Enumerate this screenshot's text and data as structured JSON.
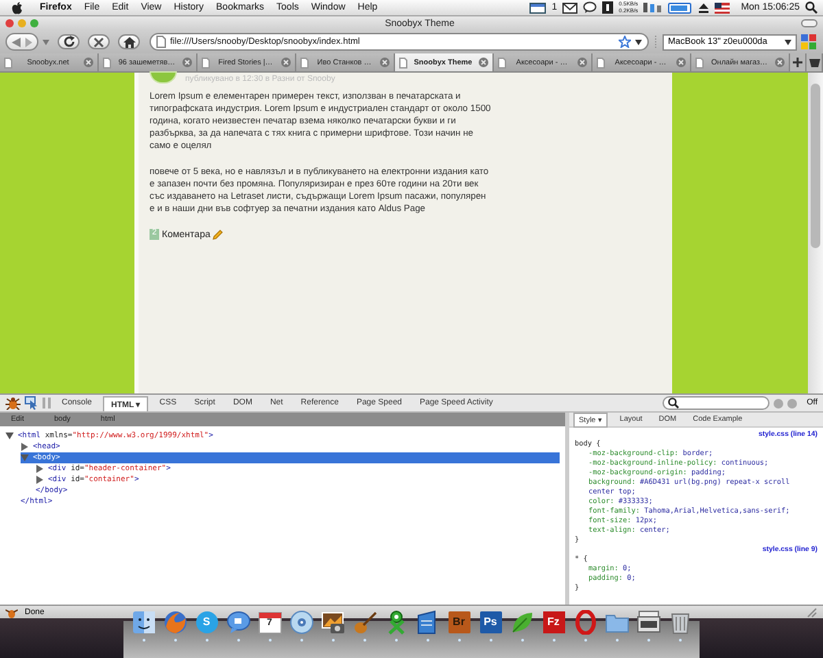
{
  "menubar": {
    "items": [
      "Firefox",
      "File",
      "Edit",
      "View",
      "History",
      "Bookmarks",
      "Tools",
      "Window",
      "Help"
    ],
    "mail_count": "1",
    "net_up": "0.5KB/s",
    "net_down": "0.2KB/s",
    "clock": "Mon 15:06:25"
  },
  "window": {
    "title": "Snoobyx Theme"
  },
  "toolbar": {
    "url": "file:///Users/snooby/Desktop/snoobyx/index.html",
    "search_value": "MacBook 13\" z0eu000da"
  },
  "tabs": [
    {
      "label": "Snoobyx.net",
      "selected": false
    },
    {
      "label": "96 зашеметяв…",
      "selected": false
    },
    {
      "label": "Fired Stories |…",
      "selected": false
    },
    {
      "label": "Иво Станков …",
      "selected": false
    },
    {
      "label": "Snoobyx Theme",
      "selected": true
    },
    {
      "label": "Аксесоари - …",
      "selected": false
    },
    {
      "label": "Аксесоари - …",
      "selected": false
    },
    {
      "label": "Онлайн магаз…",
      "selected": false
    }
  ],
  "page": {
    "meta": "публикувано в 12:30 в Разни от Snooby",
    "paragraphs": [
      "Lorem Ipsum е елементарен примерен текст, използван в печатарската и типографската индустрия. Lorem Ipsum е индустриален стандарт от около 1500 година, когато неизвестен печатар взема няколко печатарски букви и ги разбърква, за да напечата с тях книга с примерни шрифтове. Този начин не само е оцелял",
      "повече от 5 века, но е навлязъл и в публикуването на електронни издания като е запазен почти без промяна. Популяризиран е през 60те години на 20ти век със издаването на Letraset листи, съдържащи Lorem Ipsum пасажи, популярен е и в наши дни във софтуер за печатни издания като Aldus Page"
    ],
    "comment_count": "2",
    "comments_label": "Коментара"
  },
  "firebug": {
    "panels": [
      {
        "label": "Console",
        "selected": false
      },
      {
        "label": "HTML ▾",
        "selected": true
      },
      {
        "label": "CSS",
        "selected": false
      },
      {
        "label": "Script",
        "selected": false
      },
      {
        "label": "DOM",
        "selected": false
      },
      {
        "label": "Net",
        "selected": false
      },
      {
        "label": "Reference",
        "selected": false
      },
      {
        "label": "Page Speed",
        "selected": false
      },
      {
        "label": "Page Speed Activity",
        "selected": false
      }
    ],
    "off_label": "Off",
    "breadcrumbs": [
      "Edit",
      "body",
      "html"
    ],
    "side_tabs": [
      {
        "label": "Style ▾",
        "selected": true
      },
      {
        "label": "Layout",
        "selected": false
      },
      {
        "label": "DOM",
        "selected": false
      },
      {
        "label": "Code Example",
        "selected": false
      }
    ],
    "tree": [
      {
        "segments": [
          {
            "kind": "tag",
            "text": "<html "
          },
          {
            "kind": "attr",
            "text": "xmlns="
          },
          {
            "kind": "value",
            "text": "\"http://www.w3.org/1999/xhtml\""
          },
          {
            "kind": "tag",
            "text": ">"
          }
        ],
        "expanded": true,
        "selected": false,
        "close": "</html>",
        "children": [
          {
            "segments": [
              {
                "kind": "tag",
                "text": "<head>"
              }
            ],
            "expanded": false,
            "selected": false
          },
          {
            "segments": [
              {
                "kind": "tag",
                "text": "<body>"
              }
            ],
            "expanded": true,
            "selected": true,
            "close": "</body>",
            "children": [
              {
                "segments": [
                  {
                    "kind": "tag",
                    "text": "<div "
                  },
                  {
                    "kind": "attr",
                    "text": "id="
                  },
                  {
                    "kind": "value",
                    "text": "\"header-container\""
                  },
                  {
                    "kind": "tag",
                    "text": ">"
                  }
                ],
                "expanded": false,
                "selected": false
              },
              {
                "segments": [
                  {
                    "kind": "tag",
                    "text": "<div "
                  },
                  {
                    "kind": "attr",
                    "text": "id="
                  },
                  {
                    "kind": "value",
                    "text": "\"container\""
                  },
                  {
                    "kind": "tag",
                    "text": ">"
                  }
                ],
                "expanded": false,
                "selected": false
              }
            ]
          }
        ]
      }
    ],
    "rules": [
      {
        "selector": "body {",
        "source": "style.css (line 14)",
        "close": "}",
        "declarations": [
          {
            "property": "-moz-background-clip:",
            "value": "border;"
          },
          {
            "property": "-moz-background-inline-policy:",
            "value": "continuous;"
          },
          {
            "property": "-moz-background-origin:",
            "value": "padding;"
          },
          {
            "property": "background:",
            "value": "#A6D431 url(bg.png) repeat-x scroll center top;"
          },
          {
            "property": "color:",
            "value": "#333333;"
          },
          {
            "property": "font-family:",
            "value": "Tahoma,Arial,Helvetica,sans-serif;"
          },
          {
            "property": "font-size:",
            "value": "12px;"
          },
          {
            "property": "text-align:",
            "value": "center;"
          }
        ]
      },
      {
        "selector": "* {",
        "source": "style.css (line 9)",
        "close": "}",
        "declarations": [
          {
            "property": "margin:",
            "value": "0;"
          },
          {
            "property": "padding:",
            "value": "0;"
          }
        ]
      }
    ]
  },
  "status_bar": {
    "text": "Done"
  },
  "dock": [
    {
      "kind": "finder"
    },
    {
      "kind": "firefox"
    },
    {
      "kind": "skype",
      "text": "S"
    },
    {
      "kind": "ichat"
    },
    {
      "kind": "ical",
      "text": "7"
    },
    {
      "kind": "itunes"
    },
    {
      "kind": "iphoto"
    },
    {
      "kind": "guitar"
    },
    {
      "kind": "xapp"
    },
    {
      "kind": "docs"
    },
    {
      "kind": "bridge",
      "text": "Br"
    },
    {
      "kind": "photoshop",
      "text": "Ps"
    },
    {
      "kind": "leaf"
    },
    {
      "kind": "filezilla",
      "text": "Fz"
    },
    {
      "kind": "opera"
    },
    {
      "kind": "folder"
    },
    {
      "kind": "screen"
    },
    {
      "kind": "trash"
    }
  ]
}
